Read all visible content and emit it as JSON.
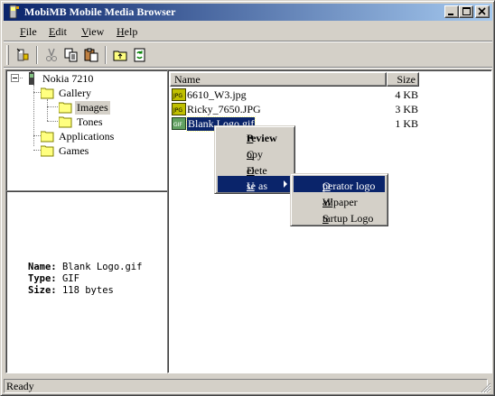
{
  "window": {
    "title": "MobiMB Mobile Media Browser"
  },
  "menubar": {
    "items": [
      {
        "key": "F",
        "rest": "ile"
      },
      {
        "key": "E",
        "rest": "dit"
      },
      {
        "key": "V",
        "rest": "iew"
      },
      {
        "key": "H",
        "rest": "elp"
      }
    ]
  },
  "toolbar": {
    "buttons": [
      "phone-connect-icon",
      "cut-icon",
      "copy-icon",
      "paste-icon",
      "folder-up-icon",
      "refresh-icon"
    ]
  },
  "tree": {
    "root": "Nokia 7210",
    "gallery": "Gallery",
    "images": "Images",
    "tones": "Tones",
    "applications": "Applications",
    "games": "Games"
  },
  "info": {
    "name_label": "Name:",
    "name_value": "Blank Logo.gif",
    "type_label": "Type:",
    "type_value": "GIF",
    "size_label": "Size:",
    "size_value": "118 bytes"
  },
  "list": {
    "columns": {
      "name": "Name",
      "size": "Size"
    },
    "files": [
      {
        "name": "6610_W3.jpg",
        "size": "4 KB",
        "type": "JPG"
      },
      {
        "name": "Ricky_7650.JPG",
        "size": "3 KB",
        "type": "JPG"
      },
      {
        "name": "Blank Logo.gif",
        "size": "1 KB",
        "type": "GIF"
      }
    ]
  },
  "context_menu": {
    "preview": {
      "key": "P",
      "rest": "review"
    },
    "copy": {
      "key": "C",
      "rest": "opy"
    },
    "delete": {
      "key": "D",
      "rest": "elete"
    },
    "use_as": {
      "key": "U",
      "rest": "se as"
    }
  },
  "submenu": {
    "operator_logo": {
      "key": "O",
      "rest": "perator logo"
    },
    "wallpaper": {
      "key": "W",
      "rest": "allpaper"
    },
    "startup_logo": {
      "key": "S",
      "rest": "tartup Logo"
    }
  },
  "status": {
    "text": "Ready"
  },
  "colors": {
    "titlebar_start": "#0a246a",
    "titlebar_end": "#a6caf0",
    "face": "#d4d0c8",
    "highlight": "#0a246a"
  }
}
